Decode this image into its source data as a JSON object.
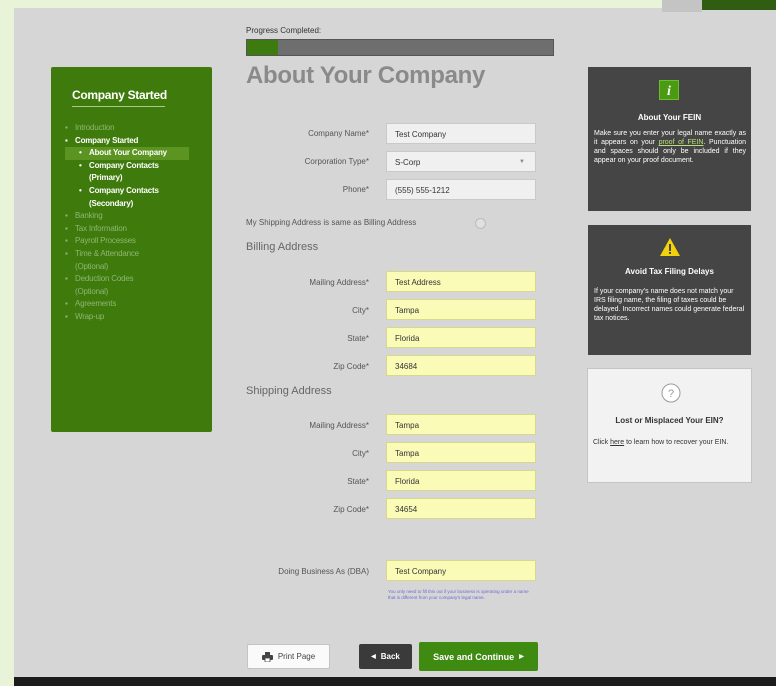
{
  "progress": {
    "label": "Progress Completed:",
    "fraction": 0.1
  },
  "page": {
    "title": "About Your Company"
  },
  "sidebar": {
    "title": "Company Started",
    "items": [
      {
        "bullet": "▪",
        "label": "Introduction",
        "state": "done"
      },
      {
        "bullet": "▪",
        "label": "Company Started",
        "state": "current"
      },
      {
        "bullet": "•",
        "label": "About Your Company",
        "state": "sub-active"
      },
      {
        "bullet": "•",
        "label": "Company Contacts",
        "state": "sub"
      },
      {
        "bullet": "",
        "label": "(Primary)",
        "state": "sub"
      },
      {
        "bullet": "•",
        "label": "Company Contacts",
        "state": "sub"
      },
      {
        "bullet": "",
        "label": "(Secondary)",
        "state": "sub"
      },
      {
        "bullet": "▪",
        "label": "Banking",
        "state": "todo"
      },
      {
        "bullet": "▪",
        "label": "Tax Information",
        "state": "todo"
      },
      {
        "bullet": "▪",
        "label": "Payroll Processes",
        "state": "todo"
      },
      {
        "bullet": "▪",
        "label": "Time & Attendance",
        "state": "todo"
      },
      {
        "bullet": "",
        "label": "(Optional)",
        "state": "todo"
      },
      {
        "bullet": "▪",
        "label": "Deduction Codes",
        "state": "todo"
      },
      {
        "bullet": "",
        "label": "(Optional)",
        "state": "todo"
      },
      {
        "bullet": "▪",
        "label": "Agreements",
        "state": "todo"
      },
      {
        "bullet": "▪",
        "label": "Wrap-up",
        "state": "todo"
      }
    ]
  },
  "company": {
    "name_label": "Company Name*",
    "name_value": "Test Company",
    "type_label": "Corporation Type*",
    "type_value": "S-Corp",
    "phone_label": "Phone*",
    "phone_value": "(555) 555-1212"
  },
  "same_address_label": "My Shipping Address is same as Billing Address",
  "billing": {
    "heading": "Billing Address",
    "mailing_label": "Mailing Address*",
    "mailing_value": "Test Address",
    "city_label": "City*",
    "city_value": "Tampa",
    "state_label": "State*",
    "state_value": "Florida",
    "zip_label": "Zip Code*",
    "zip_value": "34684"
  },
  "shipping": {
    "heading": "Shipping Address",
    "mailing_label": "Mailing Address*",
    "mailing_value": "Tampa",
    "city_label": "City*",
    "city_value": "Tampa",
    "state_label": "State*",
    "state_value": "Florida",
    "zip_label": "Zip Code*",
    "zip_value": "34654"
  },
  "dba": {
    "label": "Doing Business As (DBA)",
    "value": "Test Company",
    "hint": "You only need to fill this out if your business is operating under a name that is different from your company's legal name."
  },
  "fein_box": {
    "title": "About Your FEIN",
    "body_pre": "Make sure you enter your legal name exactly as it appears on your ",
    "body_link": "proof of FEIN",
    "body_post": ". Punctuation and spaces should only be included if they appear on your proof document.",
    "icon": "info-icon"
  },
  "tax_box": {
    "title": "Avoid Tax Filing Delays",
    "body": "If your company's name does not match your IRS filing name, the filing of taxes could be delayed. Incorrect names could generate federal tax notices.",
    "icon": "warning-icon"
  },
  "lost_box": {
    "title": "Lost or Misplaced Your EIN?",
    "body_pre": "Click ",
    "body_link": "here",
    "body_post": " to learn how to recover your EIN.",
    "icon": "question-icon"
  },
  "buttons": {
    "print": "Print Page",
    "back": "Back",
    "save": "Save and Continue"
  },
  "colors": {
    "brand_green": "#3f7a0c",
    "field_yellow": "#fbfbb8",
    "dark_box": "#454545"
  }
}
